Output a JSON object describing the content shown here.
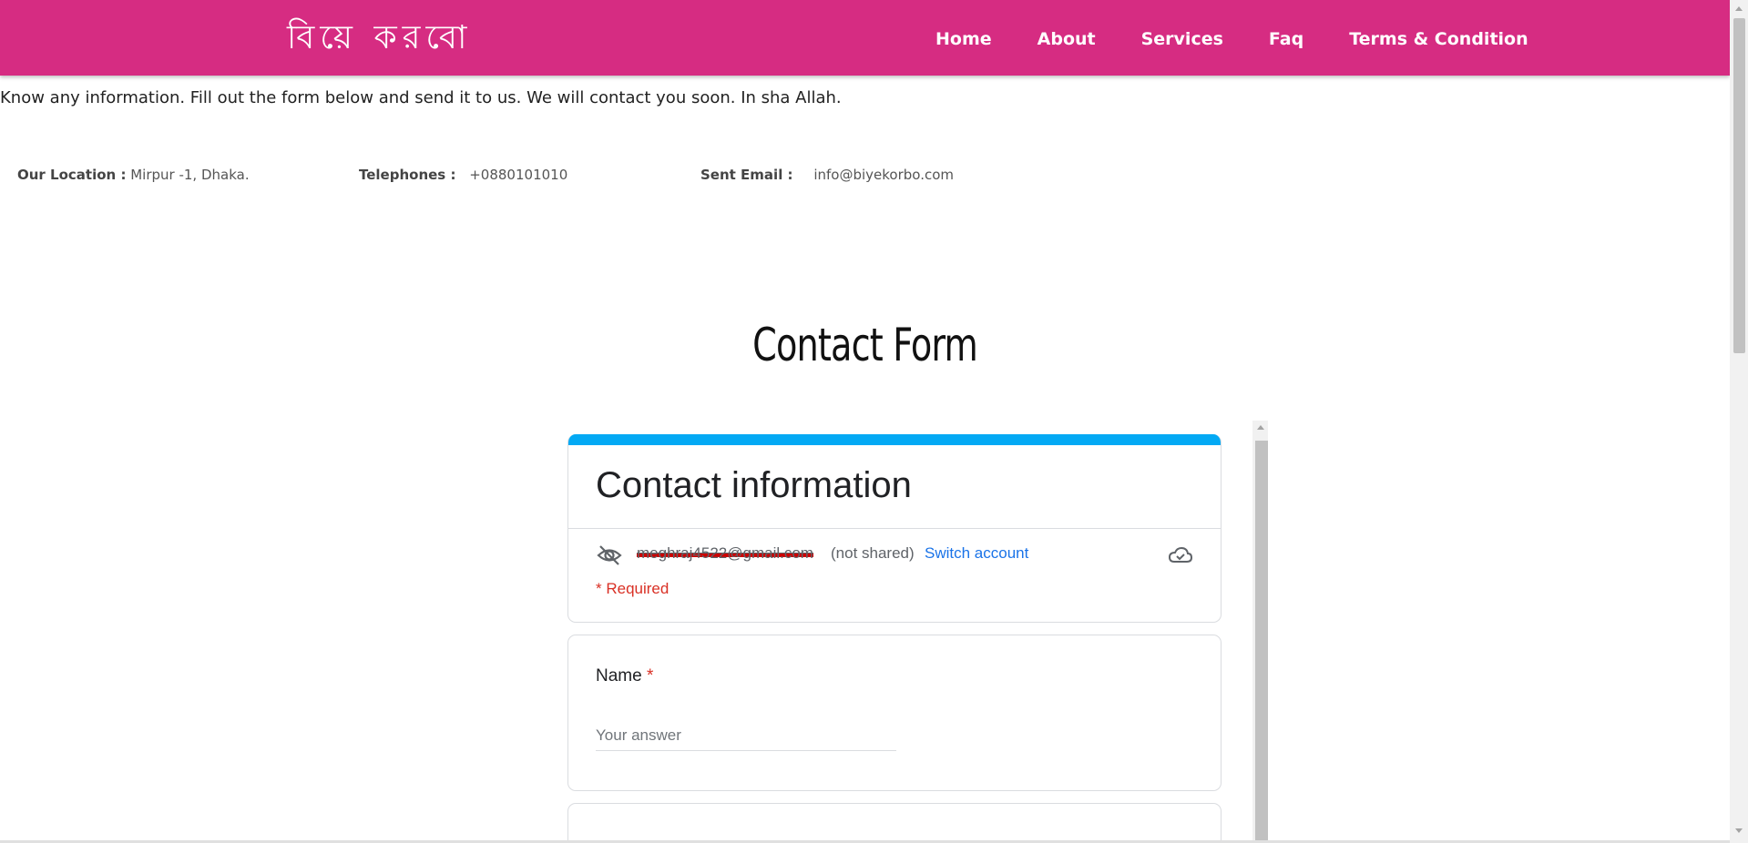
{
  "header": {
    "logo": "বিয়ে করবো",
    "nav": [
      "Home",
      "About",
      "Services",
      "Faq",
      "Terms & Condition"
    ],
    "bg_color": "#d62c82"
  },
  "intro": "Know any information. Fill out the form below and send it to us. We will contact you soon. In sha Allah.",
  "contact_info": {
    "location_label": "Our Location :",
    "location_value": "Mirpur -1, Dhaka.",
    "phone_label": "Telephones :",
    "phone_value": "+0880101010",
    "email_label": "Sent Email :",
    "email_value": "info@biyekorbo.com"
  },
  "page_title": "Contact Form",
  "form": {
    "title": "Contact information",
    "account_email": "meghraj4522@gmail.com",
    "not_shared": "(not shared)",
    "switch_account": "Switch account",
    "required_note": "* Required",
    "questions": [
      {
        "label": "Name",
        "required_mark": "*",
        "placeholder": "Your answer"
      }
    ],
    "accent_color": "#03a9f4"
  }
}
